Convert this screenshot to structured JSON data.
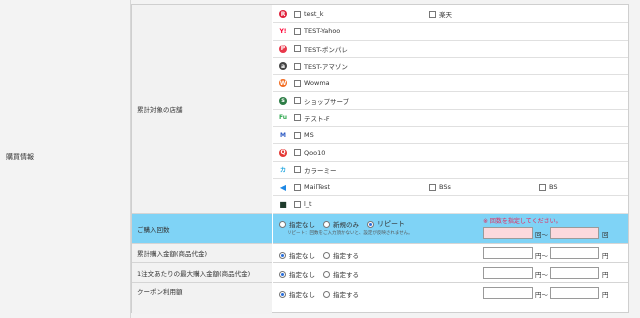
{
  "section": {
    "label": "購買情報"
  },
  "stores": {
    "label": "累計対象の店舗",
    "rows": [
      {
        "icon": "rakuten-circle-icon",
        "color": "#e0203a",
        "glyph": "R",
        "items": [
          "test_k",
          "楽天"
        ]
      },
      {
        "icon": "yahoo-icon",
        "color": "#ff0033",
        "glyph": "Y!",
        "items": [
          "TEST-Yahoo"
        ]
      },
      {
        "icon": "ponpare-icon",
        "color": "#e8374a",
        "glyph": "P",
        "items": [
          "TEST-ポンパレ"
        ]
      },
      {
        "icon": "amazon-icon",
        "color": "#444444",
        "glyph": "a",
        "items": [
          "TEST-アマゾン"
        ]
      },
      {
        "icon": "wowma-icon",
        "color": "#f26c21",
        "glyph": "W",
        "items": [
          "Wowma"
        ]
      },
      {
        "icon": "shop-serve-icon",
        "color": "#2d7d46",
        "glyph": "s",
        "items": [
          "ショップサーブ"
        ]
      },
      {
        "icon": "future-shop-icon",
        "color": "#2fa84f",
        "glyph": "Fu",
        "items": [
          "テスト-F"
        ]
      },
      {
        "icon": "makeshop-icon",
        "color": "#2b59c3",
        "glyph": "M",
        "items": [
          "MS"
        ]
      },
      {
        "icon": "qoo10-icon",
        "color": "#e53935",
        "glyph": "Q",
        "items": [
          "Qoo10"
        ]
      },
      {
        "icon": "colorme-icon",
        "color": "#26a8e0",
        "glyph": "カ",
        "items": [
          "カラーミー"
        ]
      },
      {
        "icon": "mall-arrow-icon",
        "color": "#1e88e5",
        "glyph": "◀",
        "items": [
          "MailTest",
          "BSs",
          "BS"
        ]
      },
      {
        "icon": "dark-square-icon",
        "color": "#1f3b2c",
        "glyph": "■",
        "items": [
          "l_t"
        ]
      }
    ]
  },
  "purchase_count": {
    "label": "ご購入回数",
    "options": [
      "指定なし",
      "新規のみ",
      "リピート"
    ],
    "selected": 2,
    "note": "リピート：回数をご入力頂かないと、設定が反映されません。",
    "error": "※ 回数を指定してください。",
    "unit_range": "回〜",
    "unit_end": "回",
    "error_color": "#e8265a"
  },
  "total_amount": {
    "label": "累計購入金額(商品代金)",
    "options": [
      "指定なし",
      "指定する"
    ],
    "selected": 0,
    "unit_range": "円〜",
    "unit_end": "円"
  },
  "max_amount": {
    "label": "1注文あたりの最大購入金額(商品代金)",
    "options": [
      "指定なし",
      "指定する"
    ],
    "selected": 0,
    "unit_range": "円〜",
    "unit_end": "円"
  },
  "coupon": {
    "label": "クーポン利用額",
    "options": [
      "指定なし",
      "指定する"
    ],
    "selected": 0,
    "unit_range": "円〜",
    "unit_end": "円"
  }
}
